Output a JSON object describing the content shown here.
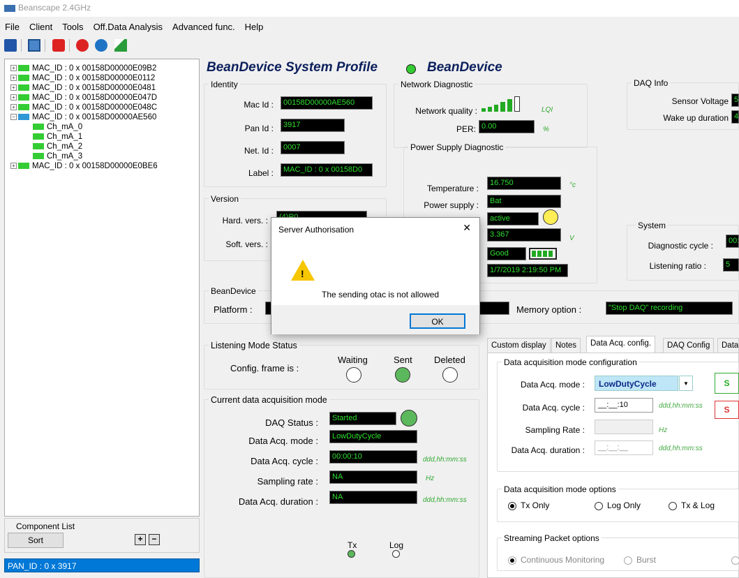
{
  "app": {
    "title": "Beanscape 2.4GHz"
  },
  "menu": [
    "File",
    "Client",
    "Tools",
    "Off.Data Analysis",
    "Advanced func.",
    "Help"
  ],
  "tree": {
    "nodes": [
      "MAC_ID : 0 x 00158D00000E09B2",
      "MAC_ID : 0 x 00158D00000E0112",
      "MAC_ID : 0 x 00158D00000E0481",
      "MAC_ID : 0 x 00158D00000E047D",
      "MAC_ID : 0 x 00158D00000E048C",
      "MAC_ID : 0 x 00158D00000AE560"
    ],
    "children": [
      "Ch_mA_0",
      "Ch_mA_1",
      "Ch_mA_2",
      "Ch_mA_3"
    ],
    "last": "MAC_ID : 0 x 00158D00000E0BE6"
  },
  "component": {
    "title": "Component List",
    "sort": "Sort"
  },
  "pan": "PAN_ID : 0 x 3917",
  "profile": {
    "title": "BeanDevice System Profile",
    "device": "BeanDevice"
  },
  "identity": {
    "title": "Identity",
    "mac_label": "Mac Id :",
    "mac": "00158D00000AE560",
    "pan_label": "Pan Id :",
    "pan": "3917",
    "net_label": "Net. Id :",
    "net": "0007",
    "label_label": "Label :",
    "label": "MAC_ID : 0 x 00158D0"
  },
  "version": {
    "title": "Version",
    "hard_label": "Hard. vers. :",
    "hard": "(4)R0",
    "soft_label": "Soft. vers. :"
  },
  "network": {
    "title": "Network Diagnostic",
    "quality_label": "Network quality :",
    "lqi": "LQI",
    "per_label": "PER:",
    "per": "0.00",
    "per_unit": "%"
  },
  "power": {
    "title": "Power Supply Diagnostic",
    "temp_label": "Temperature :",
    "temp": "16.750",
    "temp_unit": "°c",
    "supply_label": "Power supply :",
    "supply": "Bat",
    "state": "active",
    "voltage": "3.367",
    "voltage_unit": "V",
    "battery": "Good",
    "date": "1/7/2019 2:19:50 PM"
  },
  "daq_info": {
    "title": "DAQ Info",
    "sensor_label": "Sensor Voltage",
    "sensor": "5",
    "wake_label": "Wake up duration",
    "wake": "4"
  },
  "system": {
    "title": "System",
    "diag_label": "Diagnostic cycle :",
    "diag": "00:",
    "listen_label": "Listening ratio :",
    "listen": "5"
  },
  "beandevice": {
    "title": "BeanDevice",
    "platform_label": "Platform :",
    "memory_label": "Memory option :",
    "memory": "\"Stop DAQ\" recording"
  },
  "listening": {
    "title": "Listening Mode Status",
    "config": "Config. frame is :",
    "waiting": "Waiting",
    "sent": "Sent",
    "deleted": "Deleted"
  },
  "current": {
    "title": "Current data acquisition mode",
    "status_label": "DAQ Status :",
    "status": "Started",
    "mode_label": "Data Acq. mode :",
    "mode": "LowDutyCycle",
    "cycle_label": "Data Acq. cycle :",
    "cycle": "00:00:10",
    "cycle_unit": "ddd,hh:mm:ss",
    "rate_label": "Sampling rate :",
    "rate": "NA",
    "rate_unit": "Hz",
    "dur_label": "Data Acq. duration :",
    "dur": "NA",
    "dur_unit": "ddd,hh:mm:ss",
    "tx": "Tx",
    "log": "Log"
  },
  "tabs": [
    "Custom display",
    "Notes",
    "Data Acq. config.",
    "DAQ Config",
    "Data"
  ],
  "acq": {
    "title": "Data acquisition mode configuration",
    "mode_label": "Data Acq. mode :",
    "mode": "LowDutyCycle",
    "cycle_label": "Data Acq. cycle :",
    "cycle": "__:__:10",
    "cycle_unit": "ddd,hh:mm:ss",
    "rate_label": "Sampling Rate :",
    "rate_unit": "Hz",
    "dur_label": "Data Acq. duration :",
    "dur": "__:__:__",
    "dur_unit": "ddd,hh:mm:ss",
    "btn_s1": "S",
    "btn_s2": "S"
  },
  "options": {
    "title": "Data acquisition mode options",
    "tx_only": "Tx Only",
    "log_only": "Log Only",
    "tx_log": "Tx & Log"
  },
  "streaming": {
    "title": "Streaming Packet options",
    "continuous": "Continuous Monitoring",
    "burst": "Burst"
  },
  "dialog": {
    "title": "Server Authorisation",
    "message": "The sending otac is not allowed",
    "ok": "OK",
    "close": "✕"
  },
  "colors": {
    "led_green": "#33cc33",
    "selection": "#0078d7",
    "field_text": "#2fe02f"
  }
}
